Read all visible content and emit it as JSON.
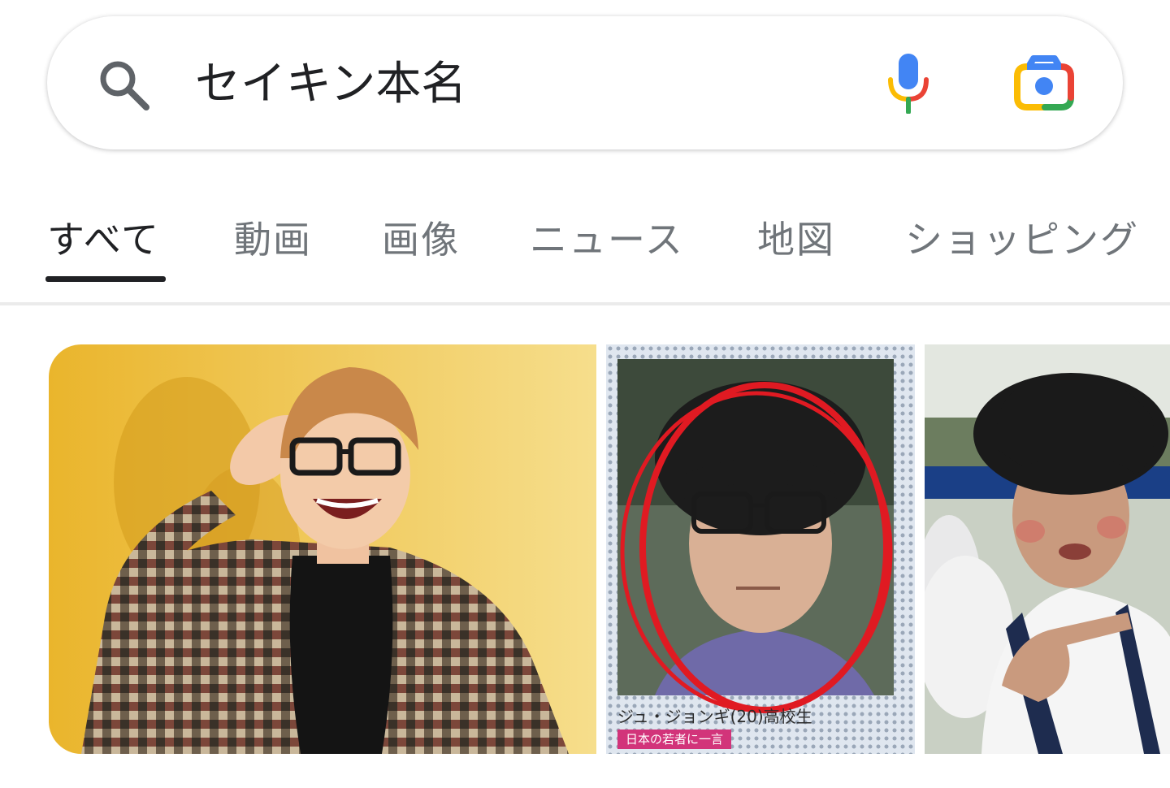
{
  "search": {
    "query": "セイキン本名",
    "icons": {
      "search": "search-icon",
      "voice": "microphone-icon",
      "lens": "google-lens-icon"
    }
  },
  "tabs": [
    {
      "label": "すべて",
      "active": true
    },
    {
      "label": "動画",
      "active": false
    },
    {
      "label": "画像",
      "active": false
    },
    {
      "label": "ニュース",
      "active": false
    },
    {
      "label": "地図",
      "active": false
    },
    {
      "label": "ショッピング",
      "active": false
    }
  ],
  "image_results": [
    {
      "id": "result-1"
    },
    {
      "id": "result-2",
      "caption": "ジュ・ジョンギ(20)高校生",
      "tag": "日本の若者に一言"
    },
    {
      "id": "result-3"
    }
  ],
  "colors": {
    "google_blue": "#4285F4",
    "google_red": "#EA4335",
    "google_yellow": "#FBBC04",
    "google_green": "#34A853",
    "text_primary": "#202124",
    "text_secondary": "#70757a"
  }
}
